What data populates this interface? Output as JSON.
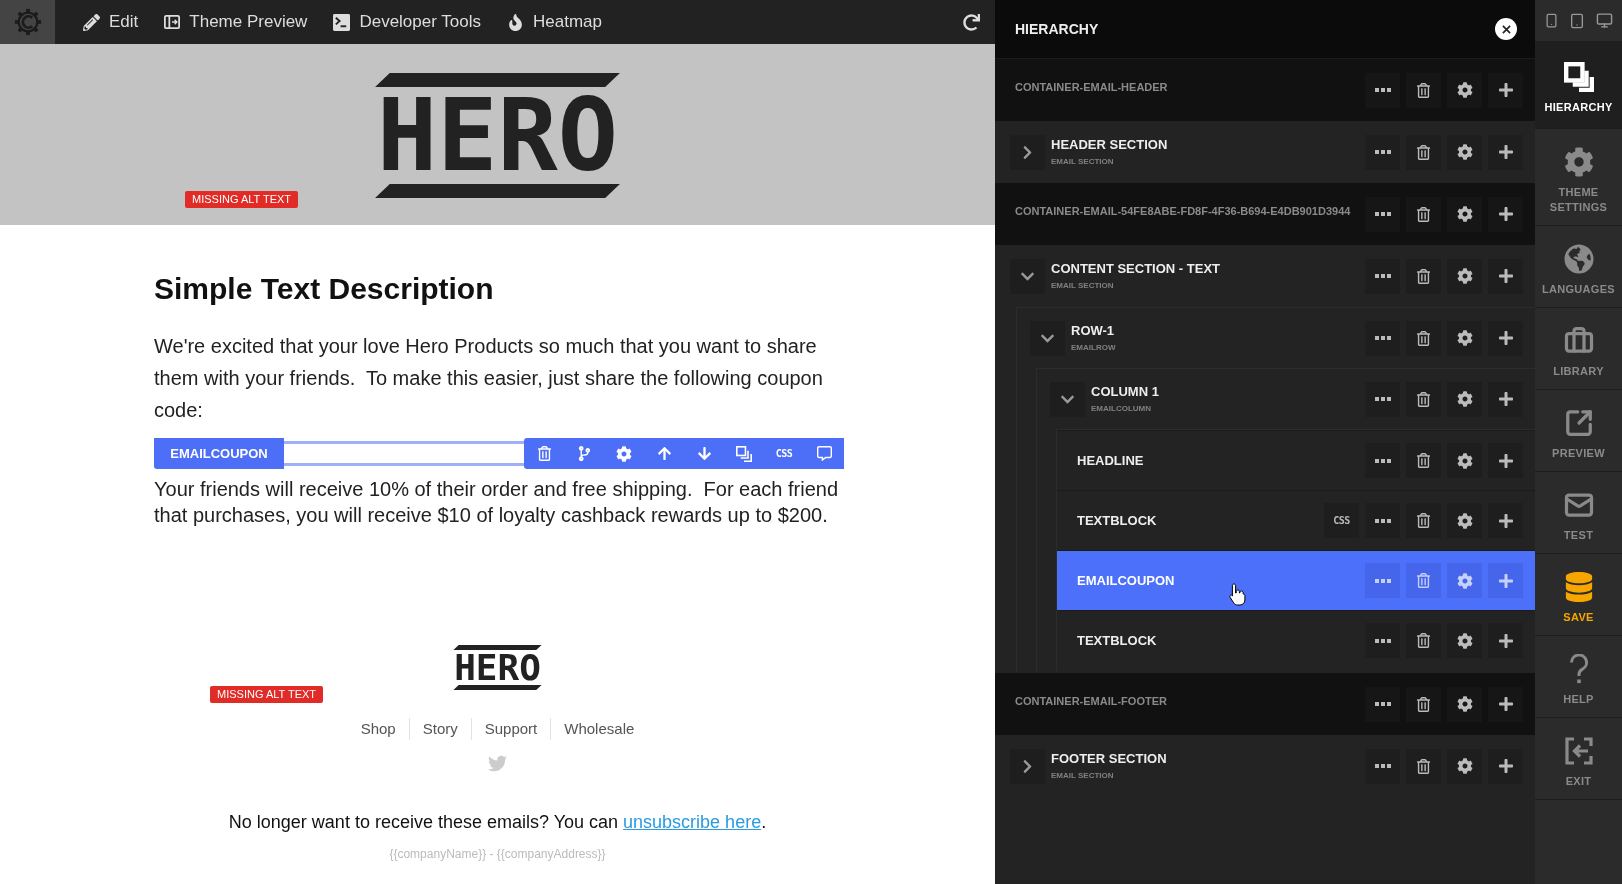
{
  "toolbar": {
    "items": [
      {
        "label": "Edit"
      },
      {
        "label": "Theme Preview"
      },
      {
        "label": "Developer Tools"
      },
      {
        "label": "Heatmap"
      }
    ]
  },
  "email": {
    "header": {
      "logo": "HERO",
      "badge": "MISSING ALT TEXT"
    },
    "headline": "Simple Text Description",
    "intro": "We're excited that your love Hero Products so much that you want to share them with your friends.  To make this easier, just share the following coupon code:",
    "coupon": {
      "tag": "EMAILCOUPON",
      "css_tool": "CSS"
    },
    "details": "Your friends will receive 10% of their order and free shipping.  For each friend that purchases, you will receive $10 of loyalty cashback rewards up to $200.",
    "footer": {
      "logo": "HERO",
      "badge": "MISSING ALT TEXT",
      "links": [
        "Shop",
        "Story",
        "Support",
        "Wholesale"
      ],
      "unsubscribe": {
        "before": "No longer want to receive these emails? You can ",
        "link": "unsubscribe here",
        "after": "."
      },
      "company": "{{companyName}} - {{companyAddress}}"
    }
  },
  "hierarchy": {
    "title": "HIERARCHY",
    "nodes": [
      {
        "kind": "container",
        "label": "CONTAINER-EMAIL-HEADER",
        "selected": false
      },
      {
        "kind": "section",
        "label": "HEADER SECTION",
        "type_label": "EMAIL SECTION",
        "expanded": false,
        "selected": false
      },
      {
        "kind": "container",
        "label": "CONTAINER-EMAIL-54FE8ABE-FD8F-4F36-B694-E4DB901D3944",
        "selected": false
      },
      {
        "kind": "section",
        "label": "CONTENT SECTION - TEXT",
        "type_label": "EMAIL SECTION",
        "expanded": true,
        "selected": false,
        "children": [
          {
            "kind": "section",
            "label": "ROW-1",
            "type_label": "EMAILROW",
            "expanded": true,
            "selected": false,
            "children": [
              {
                "kind": "section",
                "label": "COLUMN 1",
                "type_label": "EMAILCOLUMN",
                "expanded": true,
                "selected": false,
                "children": [
                  {
                    "kind": "element",
                    "label": "HEADLINE",
                    "selected": false
                  },
                  {
                    "kind": "element",
                    "label": "TEXTBLOCK",
                    "selected": false,
                    "css_button": "CSS"
                  },
                  {
                    "kind": "element",
                    "label": "EMAILCOUPON",
                    "selected": true
                  },
                  {
                    "kind": "element",
                    "label": "TEXTBLOCK",
                    "selected": false
                  }
                ]
              }
            ]
          }
        ]
      },
      {
        "kind": "container",
        "label": "CONTAINER-EMAIL-FOOTER",
        "selected": false
      },
      {
        "kind": "section",
        "label": "FOOTER SECTION",
        "type_label": "EMAIL SECTION",
        "expanded": false,
        "selected": false
      }
    ]
  },
  "sidebar": {
    "items": [
      {
        "label": "HIERARCHY",
        "selected": true,
        "highlighted": false
      },
      {
        "label": "THEME SETTINGS",
        "selected": false,
        "highlighted": false
      },
      {
        "label": "LANGUAGES",
        "selected": false,
        "highlighted": false
      },
      {
        "label": "LIBRARY",
        "selected": false,
        "highlighted": false
      },
      {
        "label": "PREVIEW",
        "selected": false,
        "highlighted": false
      },
      {
        "label": "TEST",
        "selected": false,
        "highlighted": false
      },
      {
        "label": "SAVE",
        "selected": false,
        "highlighted": true
      },
      {
        "label": "HELP",
        "selected": false,
        "highlighted": false
      },
      {
        "label": "EXIT",
        "selected": false,
        "highlighted": false
      }
    ]
  }
}
